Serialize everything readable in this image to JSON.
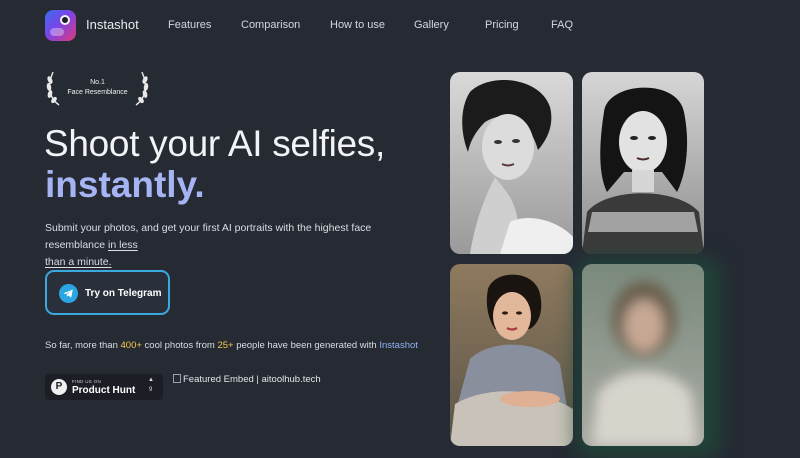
{
  "brand": {
    "name": "Instashot",
    "logo_icon": "instashot-logo-icon"
  },
  "nav": {
    "links": [
      {
        "label": "Features"
      },
      {
        "label": "Comparison"
      },
      {
        "label": "How to use"
      },
      {
        "label": "Gallery"
      },
      {
        "label": "Pricing"
      },
      {
        "label": "FAQ"
      }
    ]
  },
  "award": {
    "line1": "No.1",
    "line2": "Face Resemblance"
  },
  "hero": {
    "headline_line1": "Shoot your AI selfies,",
    "headline_line2": "instantly.",
    "sub_line_a": "Submit your photos, and get your first AI portraits with the highest face resemblance ",
    "sub_line_b": "in less",
    "sub_line_c": "than a minute.",
    "cta_label": "Try on Telegram",
    "cta_icon": "telegram-icon"
  },
  "stats": {
    "prefix": "So far, more than ",
    "photos": "400+",
    "middle": " cool photos from ",
    "people": "25+",
    "suffix": " people have been generated with ",
    "brand": "Instashot"
  },
  "producthunt": {
    "small": "FIND US ON",
    "name": "Product Hunt",
    "arrow": "▲",
    "count": "9"
  },
  "embed": {
    "alt_text": "Featured Embed | aitoolhub.tech"
  },
  "colors": {
    "background": "#252a33",
    "accent_headline": "#a6b4f4",
    "cta_border": "#3aa9df",
    "highlight_yellow": "#f3c94c",
    "highlight_blue": "#8fb3f6"
  }
}
